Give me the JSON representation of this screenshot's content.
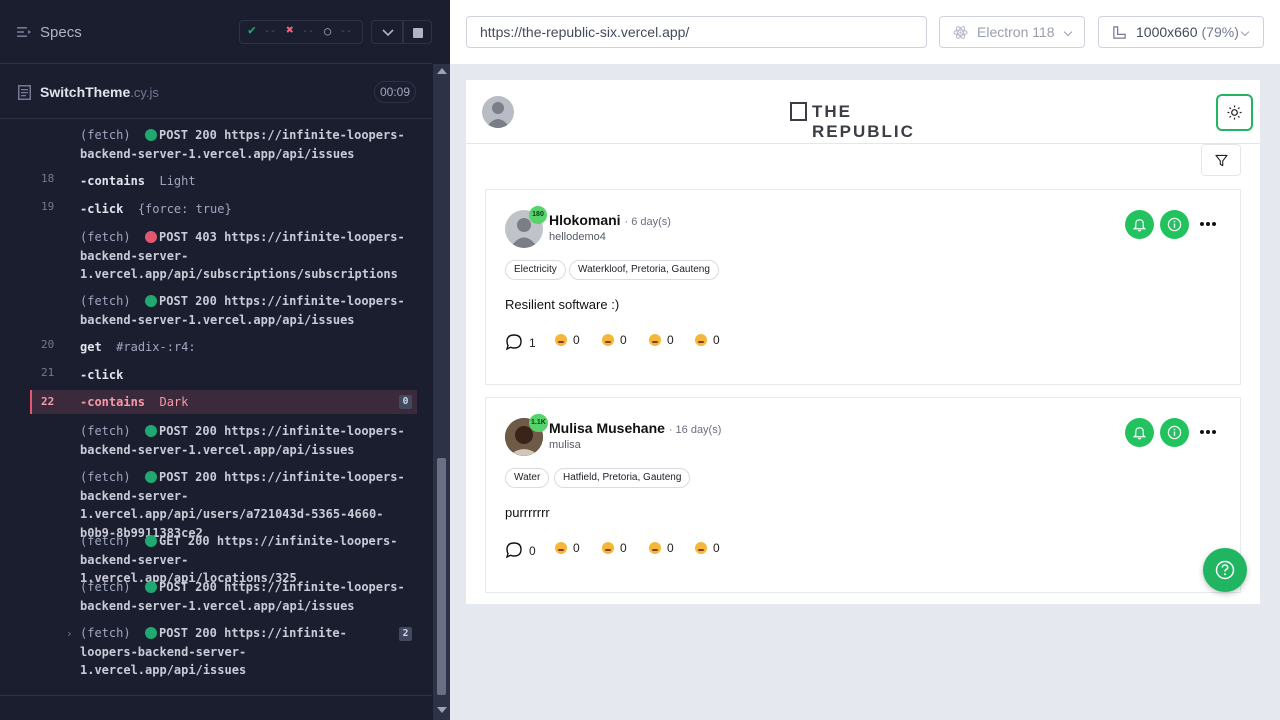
{
  "runner": {
    "specs_label": "Specs",
    "stats": {
      "passed": "--",
      "failed": "--",
      "pending": "--"
    },
    "spec_file": {
      "name": "SwitchTheme",
      "ext": ".cy.js",
      "duration": "00:09"
    },
    "commands": [
      {
        "num": "",
        "prefix": "(fetch)",
        "status": "green",
        "method": "POST 200",
        "url": "https://infinite-loopers-backend-server-1.vercel.app/api/issues"
      },
      {
        "num": "18",
        "name": "-contains",
        "arg": "Light"
      },
      {
        "num": "19",
        "name": "-click",
        "arg": "{force: true}"
      },
      {
        "num": "",
        "prefix": "(fetch)",
        "status": "red",
        "method": "POST 403",
        "url": "https://infinite-loopers-backend-server-1.vercel.app/api/subscriptions/subscriptions"
      },
      {
        "num": "",
        "prefix": "(fetch)",
        "status": "green",
        "method": "POST 200",
        "url": "https://infinite-loopers-backend-server-1.vercel.app/api/issues"
      },
      {
        "num": "20",
        "name": "get",
        "arg": "#radix-:r4:"
      },
      {
        "num": "21",
        "name": "-click",
        "arg": ""
      },
      {
        "num": "22",
        "name": "-contains",
        "arg": "Dark",
        "badge": "0"
      },
      {
        "num": "",
        "prefix": "(fetch)",
        "status": "green",
        "method": "POST 200",
        "url": "https://infinite-loopers-backend-server-1.vercel.app/api/issues"
      },
      {
        "num": "",
        "prefix": "(fetch)",
        "status": "green",
        "method": "POST 200",
        "url": "https://infinite-loopers-backend-server-1.vercel.app/api/users/a721043d-5365-4660-b0b9-8b9911383ce2"
      },
      {
        "num": "",
        "prefix": "(fetch)",
        "status": "green",
        "method": "GET 200",
        "url": "https://infinite-loopers-backend-server-1.vercel.app/api/locations/325"
      },
      {
        "num": "",
        "prefix": "(fetch)",
        "status": "green",
        "method": "POST 200",
        "url": "https://infinite-loopers-backend-server-1.vercel.app/api/issues"
      },
      {
        "num": "",
        "prefix": "(fetch)",
        "status": "green",
        "method": "POST 200",
        "url": "https://infinite-loopers-backend-server-1.vercel.app/api/issues",
        "badge": "2"
      }
    ]
  },
  "browser_bar": {
    "url": "https://the-republic-six.vercel.app/",
    "browser": "Electron 118",
    "viewport": "1000x660",
    "zoom": "(79%)"
  },
  "app": {
    "logo": "THE REPUBLIC",
    "posts": [
      {
        "name": "Hlokomani",
        "time": "· 6 day(s)",
        "username": "hellodemo4",
        "score": "180",
        "tags": [
          "Electricity",
          "Waterkloof, Pretoria, Gauteng"
        ],
        "text": "Resilient software :)",
        "comments": "1",
        "reactions": [
          "0",
          "0",
          "0",
          "0"
        ]
      },
      {
        "name": "Mulisa Musehane",
        "time": "· 16 day(s)",
        "username": "mulisa",
        "score": "1.1K",
        "tags": [
          "Water",
          "Hatfield, Pretoria, Gauteng"
        ],
        "text": "purrrrrrr",
        "comments": "0",
        "reactions": [
          "0",
          "0",
          "0",
          "0"
        ]
      }
    ]
  },
  "colors": {
    "accent_green": "#22c35e",
    "fail_red": "#e45770",
    "runner_bg": "#1b1e2e"
  }
}
